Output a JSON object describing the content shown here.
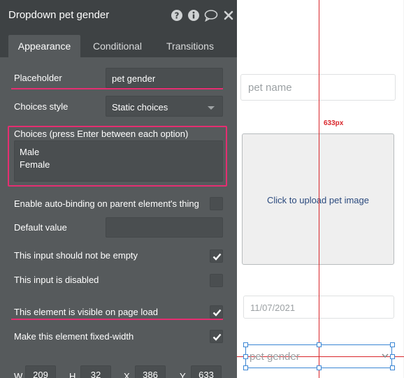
{
  "panel": {
    "title": "Dropdown pet gender",
    "header_icons": [
      "help-icon",
      "info-icon",
      "comment-icon",
      "close-icon"
    ],
    "tabs": [
      {
        "label": "Appearance",
        "active": true
      },
      {
        "label": "Conditional",
        "active": false
      },
      {
        "label": "Transitions",
        "active": false
      }
    ],
    "placeholder_label": "Placeholder",
    "placeholder_value": "pet gender",
    "choices_style_label": "Choices style",
    "choices_style_value": "Static choices",
    "choices_label": "Choices (press Enter between each option)",
    "choices": [
      "Male",
      "Female"
    ],
    "auto_binding_label": "Enable auto-binding on parent element's thing",
    "auto_binding_checked": false,
    "default_value_label": "Default value",
    "default_value": "",
    "not_empty_label": "This input should not be empty",
    "not_empty_checked": true,
    "disabled_label": "This input is disabled",
    "disabled_checked": false,
    "visible_label": "This element is visible on page load",
    "visible_checked": true,
    "fixed_width_label": "Make this element fixed-width",
    "fixed_width_checked": true,
    "coords": {
      "w_label": "W",
      "w_value": "209",
      "h_label": "H",
      "h_value": "32",
      "x_label": "X",
      "x_value": "386",
      "y_label": "Y",
      "y_value": "633"
    }
  },
  "canvas": {
    "distance_label": "633px",
    "pet_name_placeholder": "pet name",
    "upload_text": "Click to upload pet image",
    "date_value": "11/07/2021",
    "pet_gender_placeholder": "pet gender"
  },
  "colors": {
    "panel_bg": "#565a5c",
    "header_bg": "#3e4244",
    "highlight": "#e52e71",
    "guide_red": "#d9262b",
    "selection_blue": "#3a86d4"
  }
}
